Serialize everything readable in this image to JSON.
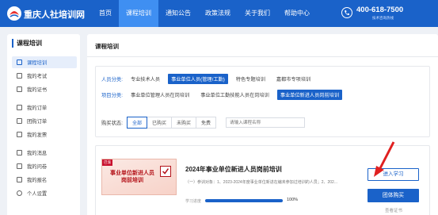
{
  "header": {
    "brand": "重庆人社培训网",
    "nav": [
      "首页",
      "课程培训",
      "通知公告",
      "政策法规",
      "关于我们",
      "帮助中心"
    ],
    "active_nav": 1,
    "phone": "400-618-7500",
    "phone_sub": "技术咨询热线"
  },
  "sidebar": {
    "title": "课程培训",
    "items": [
      {
        "label": "课程培训",
        "icon": "monitor-icon",
        "active": true
      },
      {
        "label": "我的考试",
        "icon": "exam-icon"
      },
      {
        "label": "我的证书",
        "icon": "certificate-icon"
      },
      {
        "label": "我的订单",
        "icon": "order-icon"
      },
      {
        "label": "团购订单",
        "icon": "group-order-icon"
      },
      {
        "label": "我的发票",
        "icon": "invoice-icon"
      },
      {
        "label": "我的消息",
        "icon": "message-icon"
      },
      {
        "label": "我的问卷",
        "icon": "survey-icon"
      },
      {
        "label": "我的报名",
        "icon": "signup-icon"
      },
      {
        "label": "个人设置",
        "icon": "user-settings-icon"
      }
    ]
  },
  "main": {
    "title": "课程培训",
    "filters": {
      "personnel_label": "人员分类:",
      "personnel_options": [
        "专业技术人员",
        "事业单位人员(管理/工勤)",
        "特色专题培训",
        "嘉都市专项培训"
      ],
      "personnel_active": 1,
      "project_label": "项目分类:",
      "project_options": [
        "事业单位管理人员在岗培训",
        "事业单位工勤技能人员在岗培训",
        "事业单位新进人员岗前培训"
      ],
      "project_active": 2,
      "status_label": "购买状态:",
      "status_tabs": [
        "全部",
        "已购买",
        "未购买",
        "免费"
      ],
      "status_active": 0,
      "search_placeholder": "请输入课程名称"
    },
    "course": {
      "badge": "巴渝",
      "thumb_text_1": "事业单位新进人员",
      "thumb_text_2": "岗前培训",
      "title": "2024年事业单位新进人员岗前培训",
      "description": "（一）参训对象：1、2023-2024年度事业单位新进在编未参加过培训的人员；2、202...",
      "progress_label": "学习进度",
      "progress_value": 100,
      "progress_text": "100%",
      "study_button": "进入学习",
      "buy_button": "团体购买",
      "cert_link": "查看证书"
    }
  },
  "colors": {
    "primary": "#1a62c9",
    "nav_active": "#3f8ff2",
    "annotation_arrow": "#e02020"
  }
}
